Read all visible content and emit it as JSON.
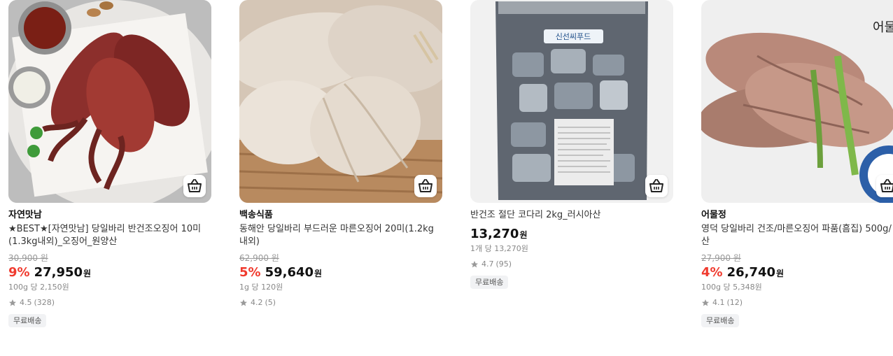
{
  "products": [
    {
      "brand": "자연맛남",
      "title": "★BEST★[자연맛남] 당일바리 반건조오징어 10미(1.3kg내외)_오징어_원양산",
      "original_price": "30,900 원",
      "discount": "9%",
      "price": "27,950",
      "currency": "원",
      "unit_price": "100g 당 2,150원",
      "rating": "4.5",
      "reviews": "(328)",
      "badge": "무료배송",
      "image_icon": "grilled-squid-image",
      "colors": {
        "bg": "#8a5b52"
      }
    },
    {
      "brand": "백송식품",
      "title": "동해안 당일바리 부드러운 마른오징어 20미(1.2kg 내외)",
      "original_price": "62,900 원",
      "discount": "5%",
      "price": "59,640",
      "currency": "원",
      "unit_price": "1g 당 120원",
      "rating": "4.2",
      "reviews": "(5)",
      "badge": "",
      "image_icon": "dried-squid-image",
      "colors": {
        "bg": "#d9c8b8"
      }
    },
    {
      "brand": "",
      "title": "반건조 절단 코다리 2kg_러시아산",
      "original_price": "",
      "discount": "",
      "price": "13,270",
      "currency": "원",
      "unit_price": "1개 당 13,270원",
      "rating": "4.7",
      "reviews": "(95)",
      "badge": "무료배송",
      "image_icon": "packaged-pollack-image",
      "package_label": "신선씨푸드",
      "colors": {
        "bg": "#eeeeee"
      }
    },
    {
      "brand": "어물정",
      "title": "영덕 당일바리 건조/마른오징어 파품(흠집) 500g/산",
      "original_price": "27,900 원",
      "discount": "4%",
      "price": "26,740",
      "currency": "원",
      "unit_price": "100g 당 5,348원",
      "rating": "4.1",
      "reviews": "(12)",
      "badge": "무료배송",
      "image_icon": "bundled-dried-squid-image",
      "logo_text": "어물",
      "colors": {
        "bg": "#b88d7f"
      }
    }
  ],
  "colors": {
    "discount": "#f03a2e",
    "badge_bg": "#f1f2f4",
    "star": "#999999"
  }
}
